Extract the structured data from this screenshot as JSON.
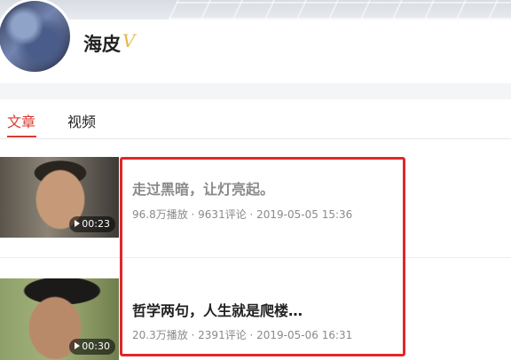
{
  "profile": {
    "name": "海皮",
    "verified_badge": "V"
  },
  "tabs": [
    {
      "label": "文章",
      "active": true
    },
    {
      "label": "视频",
      "active": false
    }
  ],
  "items": [
    {
      "title": "走过黑暗，让灯亮起。",
      "duration": "00:23",
      "meta": "96.8万播放 · 9631评论 · 2019-05-05 15:36"
    },
    {
      "title": "哲学两句，人生就是爬楼…",
      "duration": "00:30",
      "meta": "20.3万播放 · 2391评论 · 2019-05-06 16:31"
    }
  ],
  "colors": {
    "accent": "#d83b2e",
    "highlight": "#e0272b",
    "badge": "#e6b94a"
  }
}
